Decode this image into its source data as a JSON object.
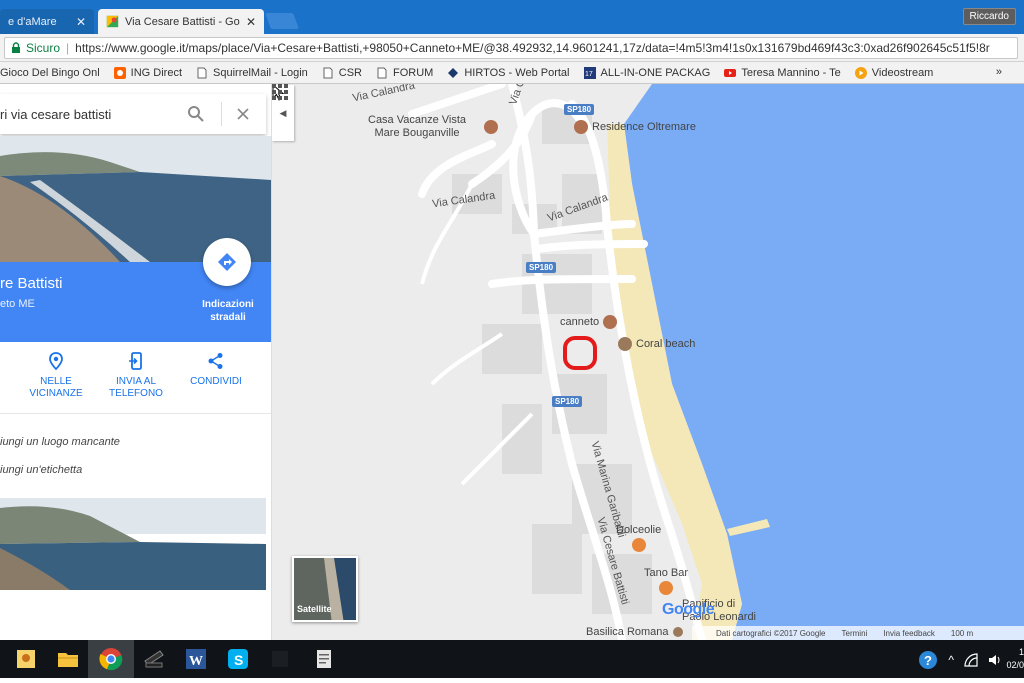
{
  "browser": {
    "tabs": [
      {
        "title": "e d'aMare",
        "active": false
      },
      {
        "title": "Via Cesare Battisti - Goo",
        "active": true
      }
    ],
    "close_glyph": "✕",
    "profile_name": "Riccardo",
    "secure_label": "Sicuro",
    "url": "https://www.google.it/maps/place/Via+Cesare+Battisti,+98050+Canneto+ME/@38.492932,14.9601241,17z/data=!4m5!3m4!1s0x131679bd469f43c3:0xad26f902645c51f5!8r",
    "bookmarks": [
      {
        "label": "Gioco Del Bingo Onl",
        "icon": "page-icon"
      },
      {
        "label": "ING Direct",
        "icon": "ing-icon"
      },
      {
        "label": "SquirrelMail - Login",
        "icon": "page-icon"
      },
      {
        "label": "CSR",
        "icon": "page-icon"
      },
      {
        "label": "FORUM",
        "icon": "page-icon"
      },
      {
        "label": "HIRTOS - Web Portal",
        "icon": "hirtos-icon"
      },
      {
        "label": "ALL-IN-ONE PACKAG",
        "icon": "aio-icon"
      },
      {
        "label": "Teresa Mannino - Te",
        "icon": "youtube-icon"
      },
      {
        "label": "Videostream",
        "icon": "videostream-icon"
      }
    ],
    "bookmarks_more": "»"
  },
  "panel": {
    "search_text": "ri via cesare battisti",
    "place_title": "re Battisti",
    "place_subtitle": "eto ME",
    "directions_label": "Indicazioni stradali",
    "actions": [
      {
        "label": "NELLE VICINANZE",
        "icon": "nearby-pin-icon"
      },
      {
        "label": "INVIA AL TELEFONO",
        "icon": "send-to-phone-icon"
      },
      {
        "label": "CONDIVIDI",
        "icon": "share-icon"
      }
    ],
    "suggestions": [
      "iungi un luogo mancante",
      "iungi un'etichetta"
    ]
  },
  "map": {
    "labels": {
      "via_calandra_1": "Via Calandra",
      "via_calandra_2": "Via Calandra",
      "via_calandra_3": "Via Calandra",
      "via_calandra_top_right": "Via C",
      "via_marina_garibaldi": "Via Marina Garibaldi",
      "via_cesare_battisti": "Via Cesare Battisti"
    },
    "shields": [
      "SP180",
      "SP180",
      "SP180"
    ],
    "pois": [
      {
        "name": "Casa Vacanze Vista Mare Bouganville",
        "line1": "Casa Vacanze Vista",
        "line2": "Mare Bouganville",
        "icon": "hotel-icon"
      },
      {
        "name": "Residence Oltremare",
        "icon": "hotel-icon"
      },
      {
        "name": "canneto",
        "icon": "hotel-icon"
      },
      {
        "name": "Coral beach",
        "icon": "place-icon"
      },
      {
        "name": "Dolceolie",
        "icon": "cafe-icon"
      },
      {
        "name": "Tano Bar",
        "icon": "bar-icon"
      },
      {
        "name": "Panificio di Paolo Leonardi",
        "line1": "Panificio di",
        "line2": "Paolo Leonardi",
        "icon": "bakery-icon"
      },
      {
        "name": "Basilica Romana",
        "icon": "church-icon"
      }
    ],
    "satellite_label": "Satellite",
    "google_logo": "Google",
    "footer": {
      "data_credits": "Dati cartografici ©2017 Google",
      "terms": "Termini",
      "feedback": "Invia feedback",
      "scale": "100 m"
    },
    "colors": {
      "land": "#ececec",
      "water": "#7aacf6",
      "beach": "#f5e8b8",
      "roads": "#ffffff",
      "marker": "#e41b1b"
    }
  },
  "taskbar": {
    "apps": [
      "explorer-icon",
      "folder-icon",
      "chrome-icon",
      "scanner-icon",
      "word-icon",
      "skype-icon",
      "app-icon",
      "notes-icon"
    ],
    "clock_time": "1",
    "clock_date": "02/0"
  }
}
